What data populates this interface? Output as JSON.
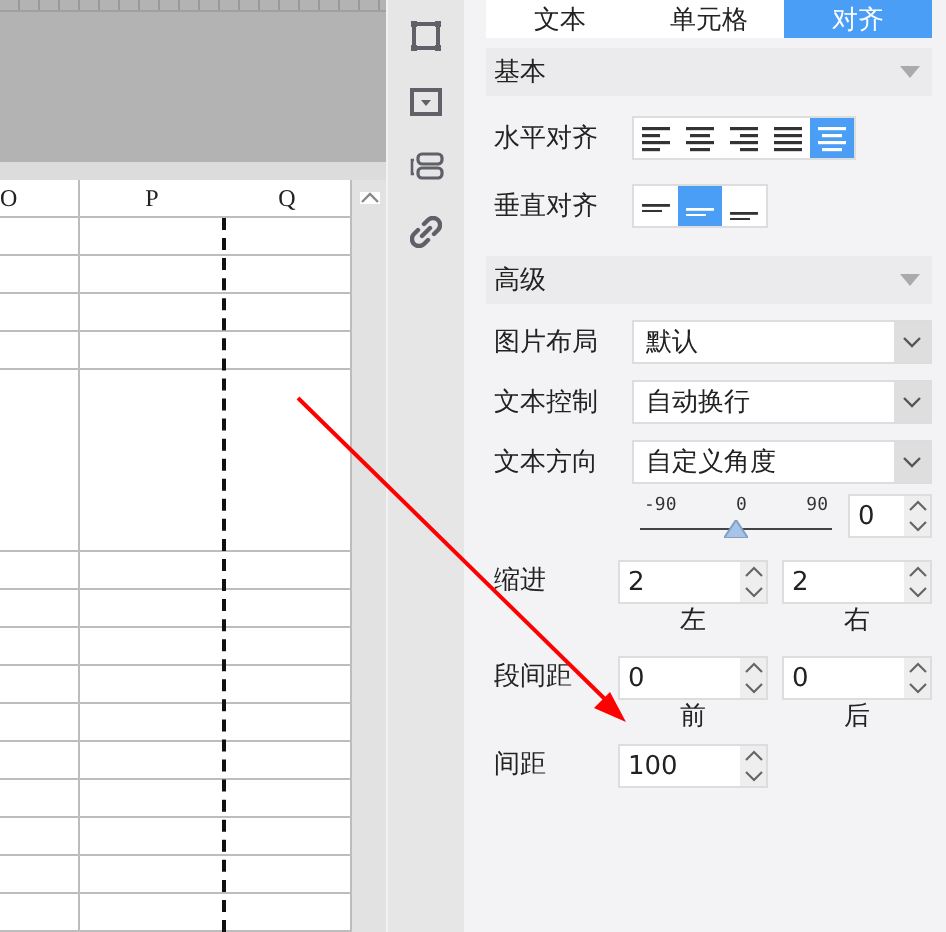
{
  "sheet": {
    "columns": [
      "O",
      "P",
      "Q"
    ]
  },
  "tool_strip": {
    "items": [
      {
        "kind": "border"
      },
      {
        "kind": "dropdown"
      },
      {
        "kind": "widget"
      },
      {
        "kind": "link"
      }
    ]
  },
  "tabs": [
    {
      "label": "文本",
      "selected": false
    },
    {
      "label": "单元格",
      "selected": false
    },
    {
      "label": "对齐",
      "selected": true
    }
  ],
  "basic": {
    "title": "基本",
    "horizontal_align": {
      "label": "水平对齐",
      "options": [
        {
          "kind": "left",
          "selected": false
        },
        {
          "kind": "center",
          "selected": false
        },
        {
          "kind": "right",
          "selected": false
        },
        {
          "kind": "justify",
          "selected": false
        },
        {
          "kind": "distributed",
          "selected": true
        }
      ]
    },
    "vertical_align": {
      "label": "垂直对齐",
      "options": [
        {
          "kind": "top",
          "selected": false
        },
        {
          "kind": "middle",
          "selected": true
        },
        {
          "kind": "bottom",
          "selected": false
        }
      ]
    }
  },
  "advanced": {
    "title": "高级",
    "dropdowns": [
      {
        "label": "图片布局",
        "value": "默认"
      },
      {
        "label": "文本控制",
        "value": "自动换行"
      },
      {
        "label": "文本方向",
        "value": "自定义角度"
      }
    ],
    "rotation": {
      "ticks": [
        "-90",
        "0",
        "90"
      ],
      "level": 0.5,
      "value": "0"
    },
    "indent": {
      "label": "缩进",
      "fields": [
        {
          "value": "2",
          "caption": "左"
        },
        {
          "value": "2",
          "caption": "右"
        }
      ]
    },
    "paragraph_spacing": {
      "label": "段间距",
      "fields": [
        {
          "value": "0",
          "caption": "前"
        },
        {
          "value": "0",
          "caption": "后"
        }
      ]
    },
    "spacing": {
      "label": "间距",
      "value": "100"
    }
  }
}
